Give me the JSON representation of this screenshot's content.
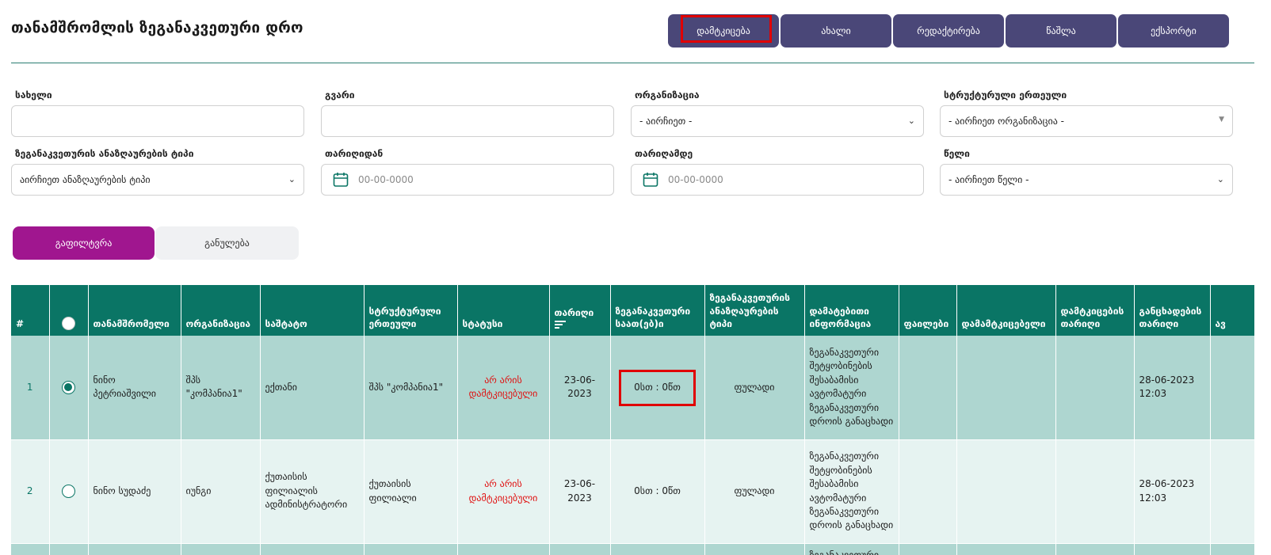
{
  "page": {
    "title": "თანამშრომლის ზეგანაკვეთური დრო"
  },
  "toolbar": {
    "approve": "დამტკიცება",
    "new": "ახალი",
    "edit": "რედაქტირება",
    "delete": "წაშლა",
    "export": "ექსპორტი"
  },
  "filters": {
    "first_name": {
      "label": "სახელი",
      "value": ""
    },
    "last_name": {
      "label": "გვარი",
      "value": ""
    },
    "organization": {
      "label": "ორგანიზაცია",
      "value": "- აირჩიეთ -"
    },
    "structural_unit": {
      "label": "სტრუქტურული ერთეული",
      "value": "- აირჩიეთ ორგანიზაცია -"
    },
    "compensation_type": {
      "label": "ზეგანაკვეთურის ანაზღაურების ტიპი",
      "value": "აირჩიეთ ანაზღაურების ტიპი"
    },
    "date_from": {
      "label": "თარიღიდან",
      "placeholder": "00-00-0000"
    },
    "date_to": {
      "label": "თარიღამდე",
      "placeholder": "00-00-0000"
    },
    "year": {
      "label": "წელი",
      "value": "- აირჩიეთ წელი -"
    },
    "filter_button": "გაფილტვრა",
    "clear_button": "განულება"
  },
  "table": {
    "headers": {
      "num": "#",
      "employee": "თანამშრომელი",
      "organization": "ორგანიზაცია",
      "position": "საშტატო",
      "structural_unit": "სტრუქტურული ერთეული",
      "status": "სტატუსი",
      "date": "თარიღი",
      "overtime_hours": "ზეგანაკვეთური საათ(ებ)ი",
      "compensation_type": "ზეგანაკვეთურის ანაზღაურების ტიპი",
      "additional_info": "დამატებითი ინფორმაცია",
      "files": "ფაილები",
      "approver": "დამამტკიცებელი",
      "approval_date": "დამტკიცების თარიღი",
      "application_date": "განცხადების თარიღი",
      "next": "ავ"
    },
    "rows": [
      {
        "num": "1",
        "selected": true,
        "employee": "ნინო პეტრიაშვილი",
        "organization": "შპს \"კომპანია1\"",
        "position": "ექთანი",
        "structural_unit": "შპს \"კომპანია1\"",
        "status": "არ არის დამტკიცებული",
        "date": "23-06-2023",
        "overtime_hours": "0სთ : 0წთ",
        "compensation_type": "ფულადი",
        "additional_info": "ზეგანაკვეთური შეტყობინების შესაბამისი ავტომატური ზეგანაკვეთური დროის განაცხადი",
        "files": "",
        "approver": "",
        "approval_date": "",
        "application_date": "28-06-2023 12:03"
      },
      {
        "num": "2",
        "selected": false,
        "employee": "ნინო სუდაძე",
        "organization": "იუნგი",
        "position": "ქუთაისის ფილიალის ადმინისტრატორი",
        "structural_unit": "ქუთაისის ფილიალი",
        "status": "არ არის დამტკიცებული",
        "date": "23-06-2023",
        "overtime_hours": "0სთ : 0წთ",
        "compensation_type": "ფულადი",
        "additional_info": "ზეგანაკვეთური შეტყობინების შესაბამისი ავტომატური ზეგანაკვეთური დროის განაცხადი",
        "files": "",
        "approver": "",
        "approval_date": "",
        "application_date": "28-06-2023 12:03"
      },
      {
        "additional_info": "ზეგანაკვეთური"
      }
    ]
  },
  "colors": {
    "toolbar_button": "#4a4778",
    "table_header": "#0a7565",
    "row_selected": "#aed6d0",
    "row_alt": "#e6f3f1",
    "filter_button": "#a0168f",
    "status_text": "#e01010",
    "highlight": "#e00000"
  },
  "icons": {
    "date_field": "calendar-icon",
    "select": "chevron-down-icon",
    "sort": "sort-icon"
  }
}
